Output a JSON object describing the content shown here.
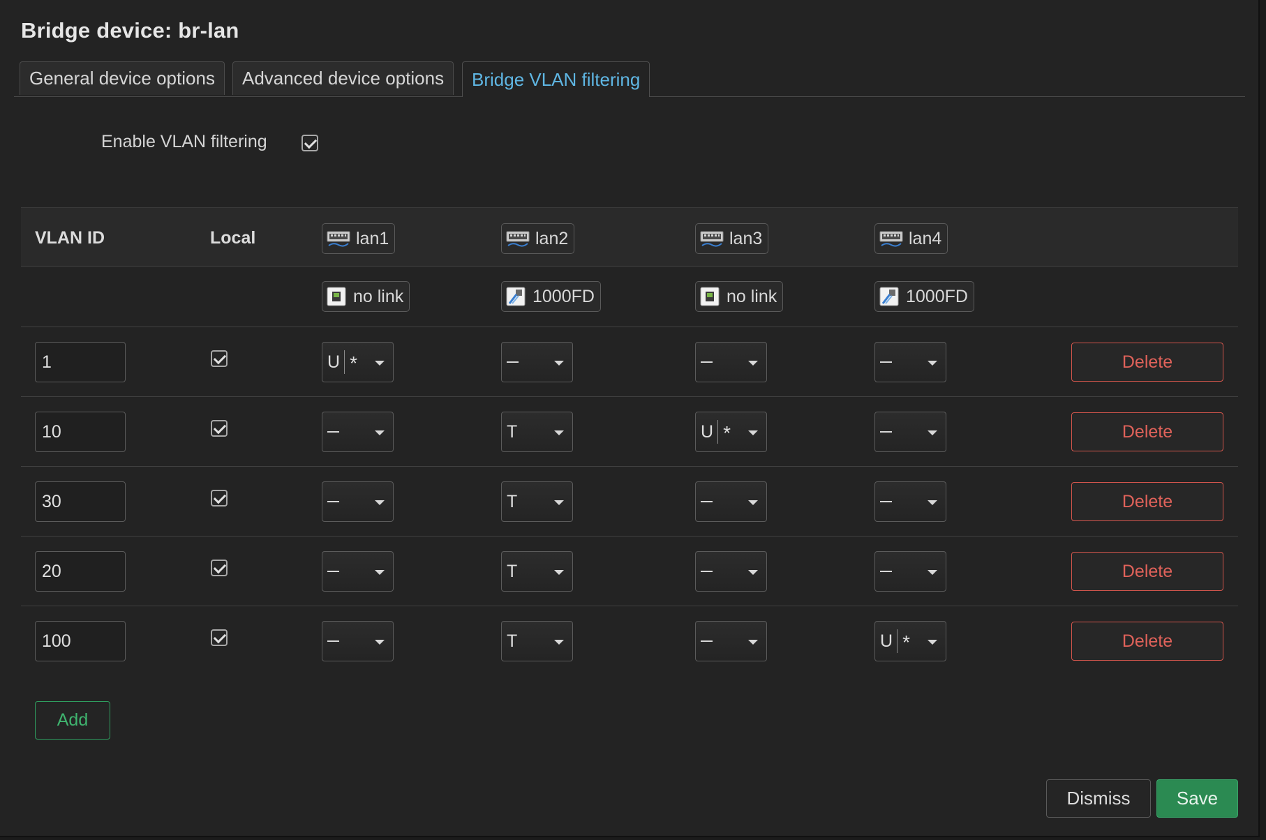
{
  "dialog": {
    "title": "Bridge device: br-lan",
    "tabs": [
      {
        "label": "General device options",
        "active": false
      },
      {
        "label": "Advanced device options",
        "active": false
      },
      {
        "label": "Bridge VLAN filtering",
        "active": true
      }
    ],
    "enable_vlan_filtering": {
      "label": "Enable VLAN filtering",
      "checked": true
    }
  },
  "table": {
    "headers": {
      "vlan_id": "VLAN ID",
      "local": "Local"
    },
    "ports": [
      {
        "name": "lan1",
        "status": "no link",
        "link": false
      },
      {
        "name": "lan2",
        "status": "1000FD",
        "link": true
      },
      {
        "name": "lan3",
        "status": "no link",
        "link": false
      },
      {
        "name": "lan4",
        "status": "1000FD",
        "link": true
      }
    ],
    "rows": [
      {
        "vlan_id": "1",
        "local": true,
        "ports": [
          {
            "mode": "U",
            "primary": true
          },
          {
            "mode": "-"
          },
          {
            "mode": "-"
          },
          {
            "mode": "-"
          }
        ],
        "delete_label": "Delete"
      },
      {
        "vlan_id": "10",
        "local": true,
        "ports": [
          {
            "mode": "-"
          },
          {
            "mode": "T"
          },
          {
            "mode": "U",
            "primary": true
          },
          {
            "mode": "-"
          }
        ],
        "delete_label": "Delete"
      },
      {
        "vlan_id": "30",
        "local": true,
        "ports": [
          {
            "mode": "-"
          },
          {
            "mode": "T"
          },
          {
            "mode": "-"
          },
          {
            "mode": "-"
          }
        ],
        "delete_label": "Delete"
      },
      {
        "vlan_id": "20",
        "local": true,
        "ports": [
          {
            "mode": "-"
          },
          {
            "mode": "T"
          },
          {
            "mode": "-"
          },
          {
            "mode": "-"
          }
        ],
        "delete_label": "Delete"
      },
      {
        "vlan_id": "100",
        "local": true,
        "ports": [
          {
            "mode": "-"
          },
          {
            "mode": "T"
          },
          {
            "mode": "-"
          },
          {
            "mode": "U",
            "primary": true
          }
        ],
        "delete_label": "Delete"
      }
    ],
    "primary_marker": "*"
  },
  "actions": {
    "add_label": "Add",
    "dismiss_label": "Dismiss",
    "save_label": "Save"
  },
  "colors": {
    "accent_tab": "#5fb6e3",
    "delete": "#e0625a",
    "add": "#3fb46f",
    "save_bg": "#2b8a52"
  }
}
